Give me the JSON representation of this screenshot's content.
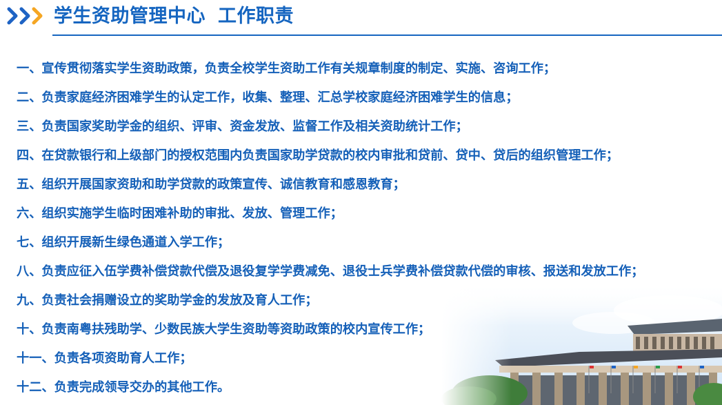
{
  "header": {
    "title_main": "学生资助管理中心",
    "title_sub": "工作职责",
    "icon": "triple-chevron-right-icon",
    "colors": {
      "title": "#1565c0",
      "chevron_blue": "#1e63c4",
      "chevron_orange": "#f5a623",
      "rule": "#1565c0"
    }
  },
  "duties": [
    "一、宣传贯彻落实学生资助政策，负责全校学生资助工作有关规章制度的制定、实施、咨询工作；",
    "二、负责家庭经济困难学生的认定工作，收集、整理、汇总学校家庭经济困难学生的信息；",
    "三、负责国家奖助学金的组织、评审、资金发放、监督工作及相关资助统计工作；",
    "四、在贷款银行和上级部门的授权范围内负责国家助学贷款的校内审批和贷前、贷中、贷后的组织管理工作；",
    "五、组织开展国家资助和助学贷款的政策宣传、诚信教育和感恩教育；",
    "六、组织实施学生临时困难补助的审批、发放、管理工作；",
    "七、组织开展新生绿色通道入学工作；",
    "八、负责应征入伍学费补偿贷款代偿及退役复学学费减免、退役士兵学费补偿贷款代偿的审核、报送和发放工作；",
    "九、负责社会捐赠设立的奖助学金的发放及育人工作；",
    "十、负责南粤扶残助学、少数民族大学生资助等资助政策的校内宣传工作；",
    "十一、负责各项资助育人工作；",
    "十二、负责完成领导交办的其他工作。"
  ],
  "decor": {
    "image": "campus-building-illustration",
    "text_color": "#1560b8"
  }
}
